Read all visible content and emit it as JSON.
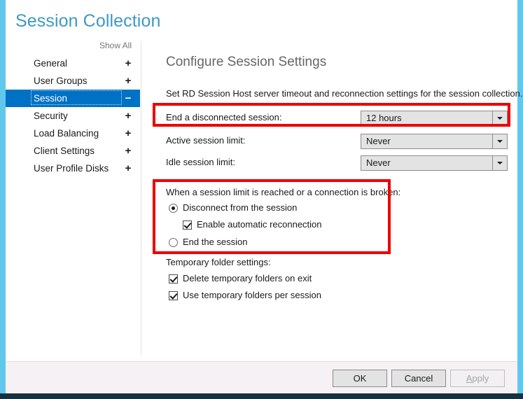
{
  "window": {
    "title": "Session Collection"
  },
  "sidebar": {
    "show_all_label": "Show All",
    "items": [
      {
        "label": "General",
        "toggle": "+",
        "selected": false
      },
      {
        "label": "User Groups",
        "toggle": "+",
        "selected": false
      },
      {
        "label": "Session",
        "toggle": "−",
        "selected": true
      },
      {
        "label": "Security",
        "toggle": "+",
        "selected": false
      },
      {
        "label": "Load Balancing",
        "toggle": "+",
        "selected": false
      },
      {
        "label": "Client Settings",
        "toggle": "+",
        "selected": false
      },
      {
        "label": "User Profile Disks",
        "toggle": "+",
        "selected": false
      }
    ]
  },
  "content": {
    "heading": "Configure Session Settings",
    "description": "Set RD Session Host server timeout and reconnection settings for the session collection.",
    "timeouts": [
      {
        "label": "End a disconnected session:",
        "value": "12 hours"
      },
      {
        "label": "Active session limit:",
        "value": "Never"
      },
      {
        "label": "Idle session limit:",
        "value": "Never"
      }
    ],
    "session_limit_group": {
      "caption": "When a session limit is reached or a connection is broken:",
      "options": [
        {
          "label": "Disconnect from the session",
          "type": "radio",
          "checked": true,
          "indent": false
        },
        {
          "label": "Enable automatic reconnection",
          "type": "checkbox",
          "checked": true,
          "indent": true
        },
        {
          "label": "End the session",
          "type": "radio",
          "checked": false,
          "indent": false
        }
      ]
    },
    "temp_folder_group": {
      "caption": "Temporary folder settings:",
      "options": [
        {
          "label": "Delete temporary folders on exit",
          "type": "checkbox",
          "checked": true
        },
        {
          "label": "Use temporary folders per session",
          "type": "checkbox",
          "checked": true
        }
      ]
    }
  },
  "footer": {
    "ok_label": "OK",
    "cancel_label": "Cancel",
    "apply_label_prefix": "A",
    "apply_label_rest": "pply",
    "apply_disabled": true
  },
  "colors": {
    "window_border": "#62c7ec",
    "title_text": "#3d9ac4",
    "selection": "#0072c6",
    "annotation": "#ee0000",
    "footer_bg": "#f6f1f5"
  }
}
